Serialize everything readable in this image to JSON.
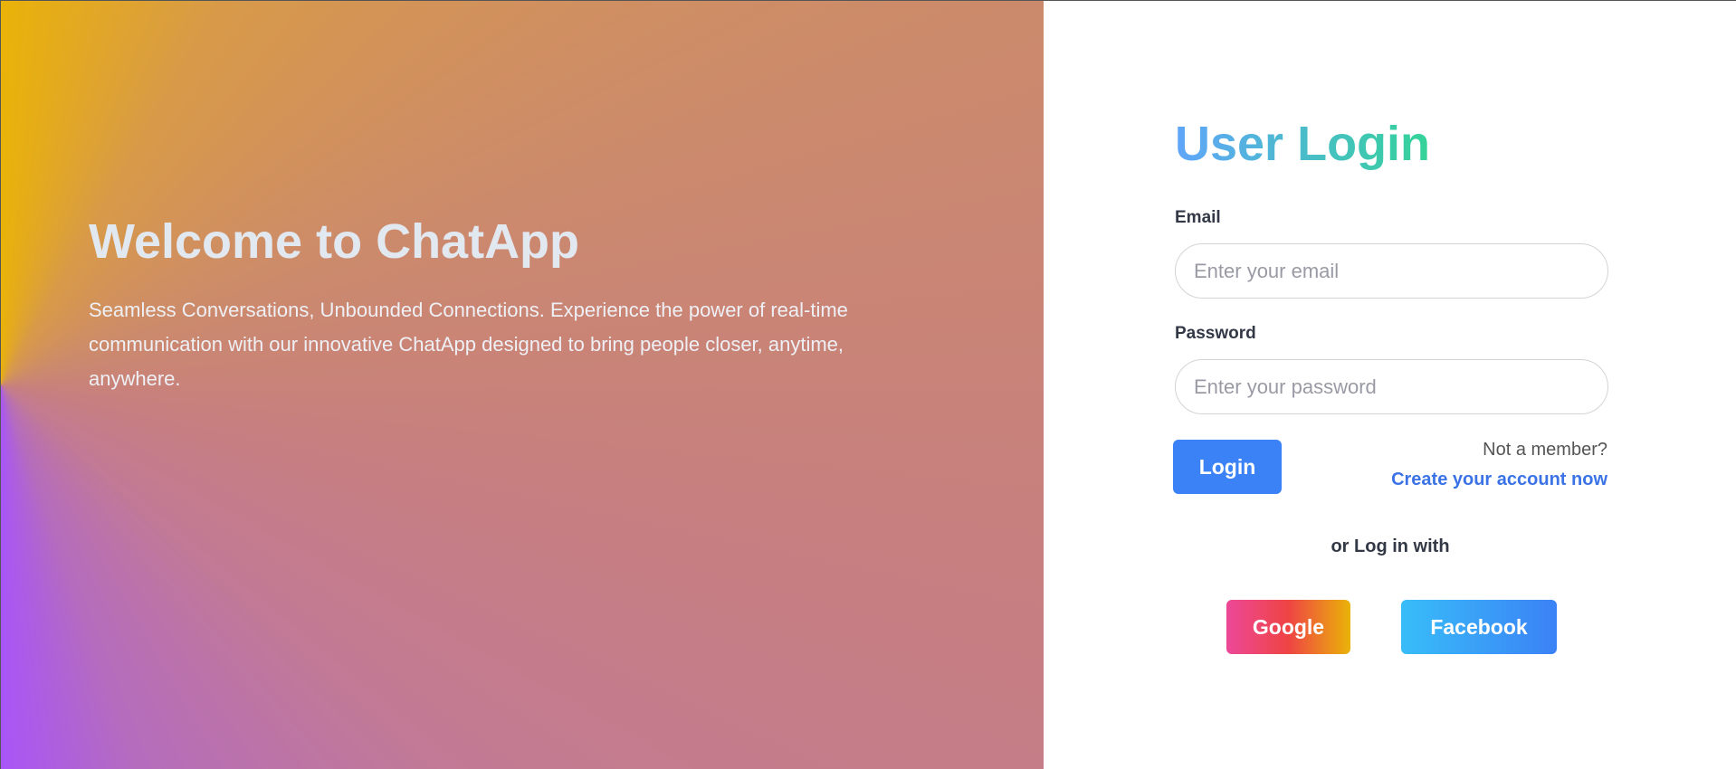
{
  "hero": {
    "title": "Welcome to ChatApp",
    "description": "Seamless Conversations, Unbounded Connections. Experience the power of real-time communication with our innovative ChatApp designed to bring people closer, anytime, anywhere."
  },
  "login": {
    "title": "User Login",
    "email_label": "Email",
    "email_placeholder": "Enter your email",
    "email_value": "",
    "password_label": "Password",
    "password_placeholder": "Enter your password",
    "password_value": "",
    "login_button": "Login",
    "not_member": "Not a member?",
    "create_account": "Create your account now",
    "or_login_with": "or Log in with",
    "google_button": "Google",
    "facebook_button": "Facebook"
  },
  "colors": {
    "accent": "#3b82f6",
    "title_gradient": [
      "#60a5fa",
      "#34d399"
    ],
    "google_gradient": [
      "#ec4899",
      "#ef4444",
      "#eab308"
    ],
    "facebook_gradient": [
      "#38bdf8",
      "#3b82f6"
    ],
    "hero_gradient": [
      "#eab308",
      "#c77f80",
      "#a855f7"
    ]
  }
}
